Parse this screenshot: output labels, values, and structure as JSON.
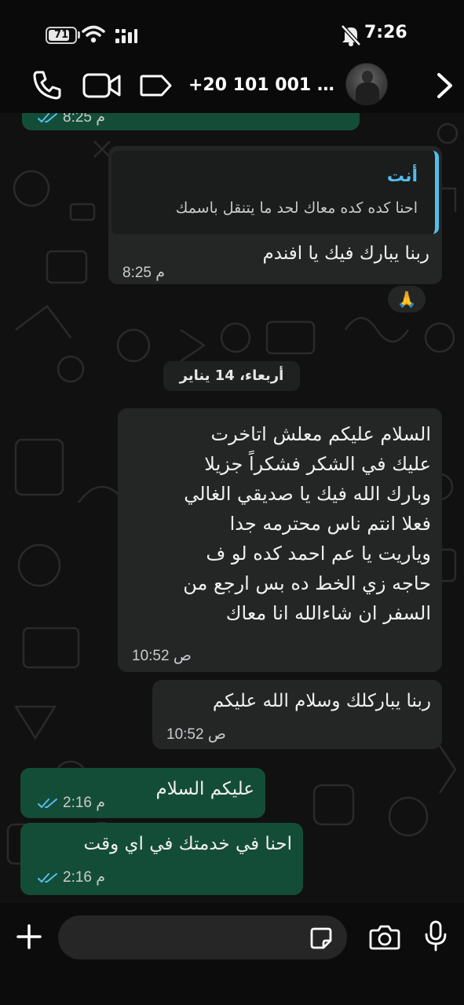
{
  "status_bar": {
    "battery": "71",
    "time": "7:26"
  },
  "header": {
    "contact_name": "+20 101 001 0..."
  },
  "messages": [
    {
      "direction": "out",
      "text": "",
      "time": "8:25 م"
    },
    {
      "direction": "in",
      "quote": {
        "author": "أنت",
        "text": "احنا كده كده معاك لحد ما يتنقل باسمك"
      },
      "text": "ربنا يبارك فيك يا افندم",
      "time": "8:25 م",
      "reaction": "🙏"
    },
    {
      "direction": "in",
      "lines": [
        "السلام عليكم معلش اتاخرت",
        "عليك في الشكر فشكراً جزيلا",
        "وبارك الله فيك يا صديقي الغالي",
        "فعلا انتم ناس محترمه جدا",
        "وياريت يا عم احمد كده لو ف",
        "حاجه زي الخط ده بس ارجع من",
        "السفر ان شاءالله انا معاك"
      ],
      "time": "10:52 ص"
    },
    {
      "direction": "in",
      "text": "ربنا يباركلك وسلام الله عليكم",
      "time": "10:52 ص"
    },
    {
      "direction": "out",
      "text": "عليكم السلام",
      "time": "2:16 م"
    },
    {
      "direction": "out",
      "text": "احنا في خدمتك في اي وقت",
      "time": "2:16 م"
    }
  ],
  "date_separator": "أربعاء، 14 يناير",
  "input": {
    "placeholder": "",
    "value": ""
  },
  "colors": {
    "incoming_bubble": "#242626",
    "outgoing_bubble": "#144d37",
    "quote_bar": "#53bdeb",
    "quote_author": "#53bdeb",
    "read_ticks": "#53bdeb"
  },
  "icons": [
    "phone-icon",
    "video-icon",
    "label-icon",
    "chevron-right-icon",
    "plus-icon",
    "sticker-icon",
    "camera-icon",
    "mic-icon",
    "wifi-icon",
    "signal-icon",
    "mute-icon",
    "double-check-icon"
  ]
}
